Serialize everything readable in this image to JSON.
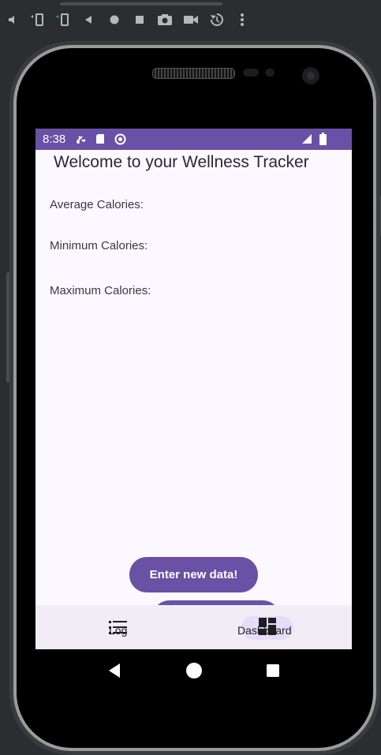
{
  "emulator_toolbar": {
    "icons": [
      "volume-icon",
      "rotate-left-icon",
      "rotate-right-icon",
      "back-icon",
      "home-icon",
      "overview-icon",
      "camera-icon",
      "video-icon",
      "replay-icon",
      "more-icon"
    ]
  },
  "status_bar": {
    "time": "8:38",
    "icons": [
      "notification-icon",
      "sd-card-icon",
      "sync-icon",
      "signal-icon",
      "battery-icon"
    ]
  },
  "app": {
    "title": "Welcome to your Wellness Tracker",
    "stats": {
      "average_label": "Average Calories:",
      "minimum_label": "Minimum Calories:",
      "maximum_label": "Maximum Calories:"
    },
    "enter_button": "Enter new data!"
  },
  "bottom_nav": {
    "items": [
      {
        "label": "Log",
        "icon": "list-icon"
      },
      {
        "label": "Dashboard",
        "icon": "dashboard-icon"
      }
    ]
  },
  "colors": {
    "accent": "#6a50a6",
    "screen_bg": "#fcf8ff",
    "nav_bg": "#f1ecf6",
    "indicator": "#e6dcf8"
  }
}
